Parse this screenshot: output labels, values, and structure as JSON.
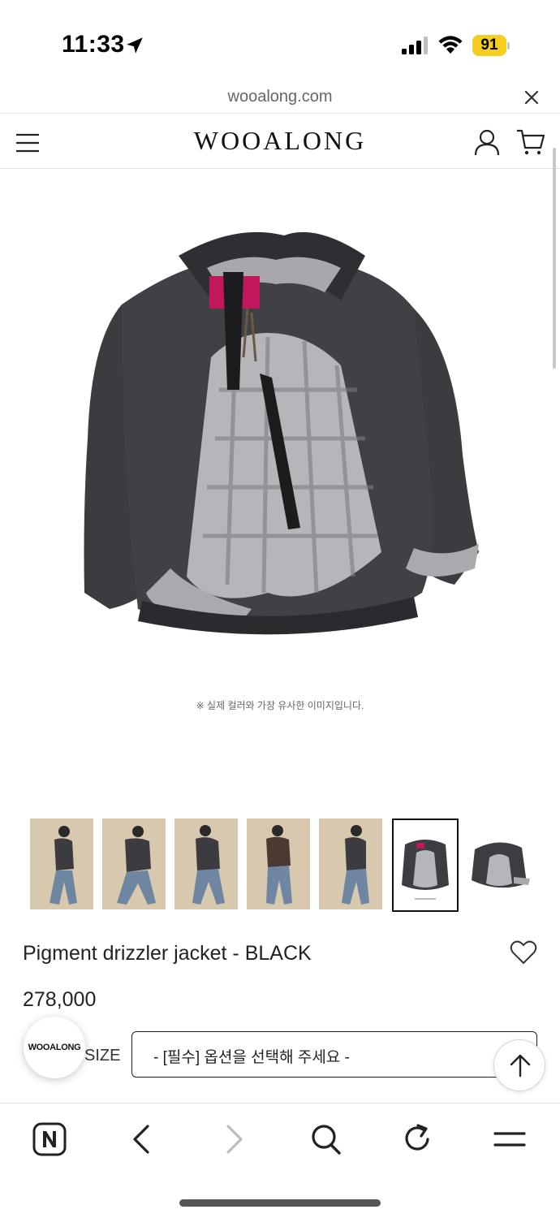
{
  "status_bar": {
    "time": "11:33",
    "battery": "91",
    "battery_color": "#f5cd1f"
  },
  "browser": {
    "url": "wooalong.com"
  },
  "header": {
    "logo": "WOOALONG"
  },
  "product": {
    "image_note": "※ 실제 컬러와 가장 유사한 이미지입니다.",
    "title": "Pigment drizzler jacket - BLACK",
    "price": "278,000",
    "size_label": "SIZE",
    "option_placeholder": "- [필수] 옵션을 선택해 주세요 -",
    "thumbnails": [
      {
        "kind": "model"
      },
      {
        "kind": "model"
      },
      {
        "kind": "model"
      },
      {
        "kind": "model"
      },
      {
        "kind": "model"
      },
      {
        "kind": "product",
        "selected": true
      },
      {
        "kind": "product"
      }
    ]
  },
  "floating": {
    "logo": "WOOALONG"
  },
  "bottom_nav": [
    "naver-home-icon",
    "back-icon",
    "forward-icon",
    "search-icon",
    "refresh-icon",
    "menu-icon"
  ],
  "colors": {
    "jacket": "#3a3b3f",
    "lining": "#b8b8bc",
    "tag": "#c1175d",
    "thumb_bg": "#d8c9ae"
  }
}
